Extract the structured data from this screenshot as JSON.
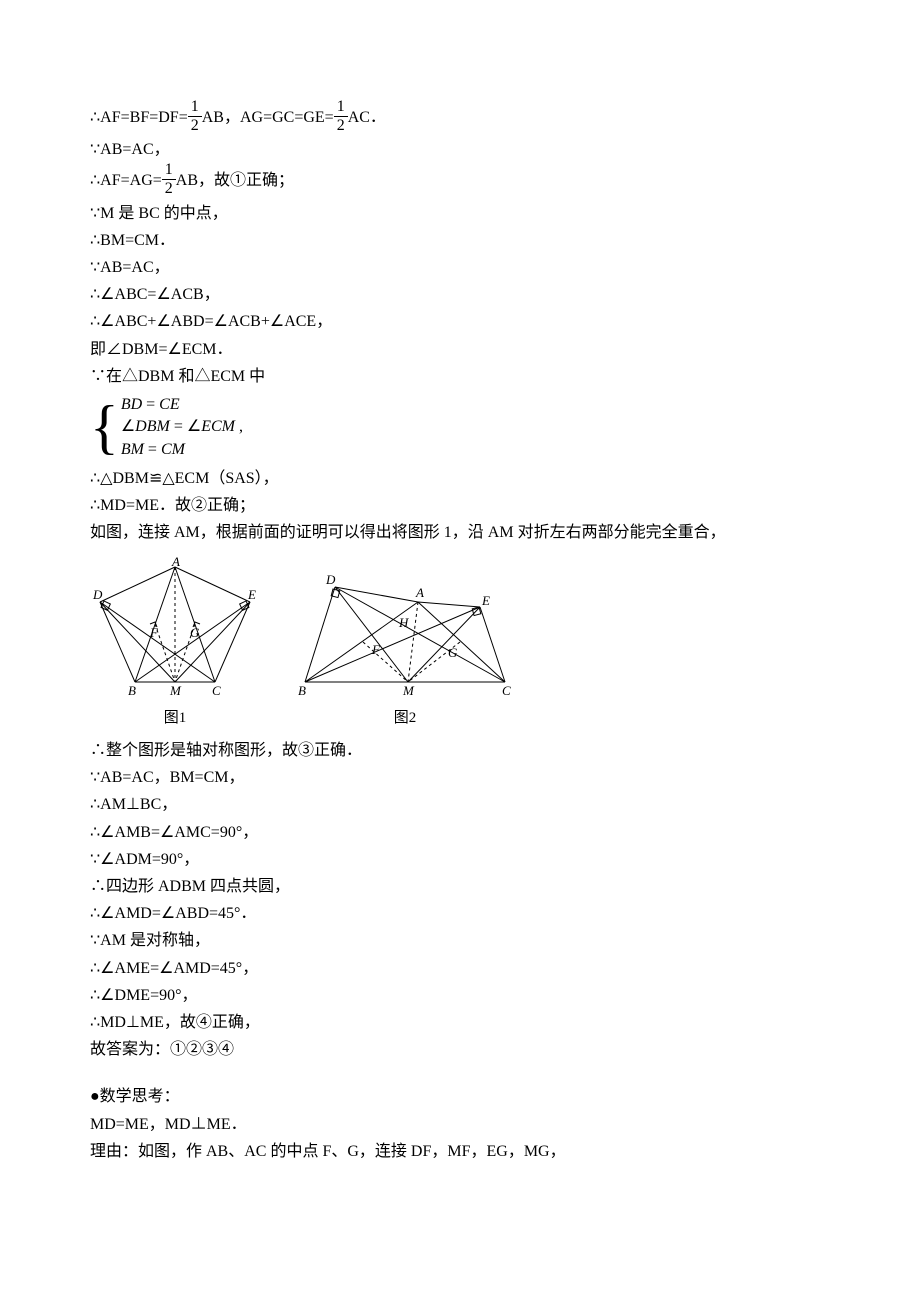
{
  "lines": {
    "l1a": "∴AF=BF=DF=",
    "l1b": "AB，AG=GC=GE=",
    "l1c": "AC．",
    "l2": "∵AB=AC，",
    "l3a": "∴AF=AG=",
    "l3b": "AB，故①正确；",
    "l4": "∵M 是 BC 的中点，",
    "l5": "∴BM=CM．",
    "l6": "∵AB=AC，",
    "l7": "∴∠ABC=∠ACB，",
    "l8": "∴∠ABC+∠ABD=∠ACB+∠ACE，",
    "l9": "即∠DBM=∠ECM．",
    "l10": "∵在△DBM 和△ECM 中",
    "b1": "BD",
    "b1eq": " = ",
    "b1r": "CE",
    "b2": "∠DBM",
    "b2eq": " = ",
    "b2r": "∠ECM",
    "b2p": " ,",
    "b3": "BM",
    "b3eq": " = ",
    "b3r": "CM",
    "l11": "∴△DBM≌△ECM（SAS），",
    "l12": "∴MD=ME．故②正确；",
    "l13": "如图，连接 AM，根据前面的证明可以得出将图形 1，沿 AM 对折左右两部分能完全重合，",
    "cap1": "图1",
    "cap2": "图2",
    "l14": "∴整个图形是轴对称图形，故③正确．",
    "l15": "∵AB=AC，BM=CM，",
    "l16": "∴AM⊥BC，",
    "l17": "∴∠AMB=∠AMC=90°，",
    "l18": "∵∠ADM=90°，",
    "l19": "∴四边形 ADBM 四点共圆，",
    "l20": "∴∠AMD=∠ABD=45°．",
    "l21": "∵AM 是对称轴，",
    "l22": "∴∠AME=∠AMD=45°，",
    "l23": "∴∠DME=90°，",
    "l24": "∴MD⊥ME，故④正确，",
    "l25": "故答案为：①②③④",
    "l26": "●数学思考：",
    "l27": "MD=ME，MD⊥ME．",
    "l28": "理由：如图，作 AB、AC 的中点 F、G，连接 DF，MF，EG，MG，",
    "fr_num": "1",
    "fr_den": "2"
  },
  "fig1": {
    "A": "A",
    "B": "B",
    "C": "C",
    "D": "D",
    "E": "E",
    "F": "F",
    "G": "G",
    "M": "M"
  },
  "fig2": {
    "A": "A",
    "B": "B",
    "C": "C",
    "D": "D",
    "E": "E",
    "F": "F",
    "G": "G",
    "H": "H",
    "M": "M"
  }
}
